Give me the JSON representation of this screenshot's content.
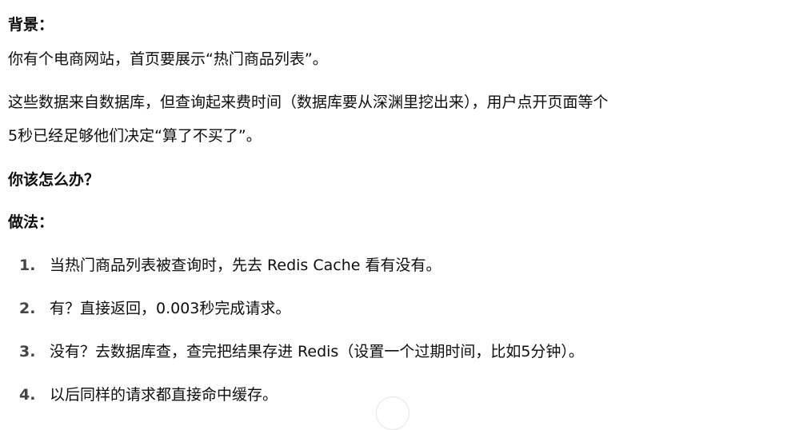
{
  "sections": {
    "background_heading": "背景：",
    "background_line1": "你有个电商网站，首页要展示“热门商品列表”。",
    "background_line2a": "这些数据来自数据库，但查询起来费时间（数据库要从深渊里挖出来），用户点开页面等个",
    "background_line2b": "5秒已经足够他们决定“算了不买了”。",
    "question": "你该怎么办？",
    "method_heading": "做法："
  },
  "steps": [
    {
      "num": "1.",
      "text": "当热门商品列表被查询时，先去 Redis Cache 看有没有。"
    },
    {
      "num": "2.",
      "text": "有？直接返回，0.003秒完成请求。"
    },
    {
      "num": "3.",
      "text": "没有？去数据库查，查完把结果存进 Redis（设置一个过期时间，比如5分钟）。"
    },
    {
      "num": "4.",
      "text": "以后同样的请求都直接命中缓存。"
    }
  ]
}
